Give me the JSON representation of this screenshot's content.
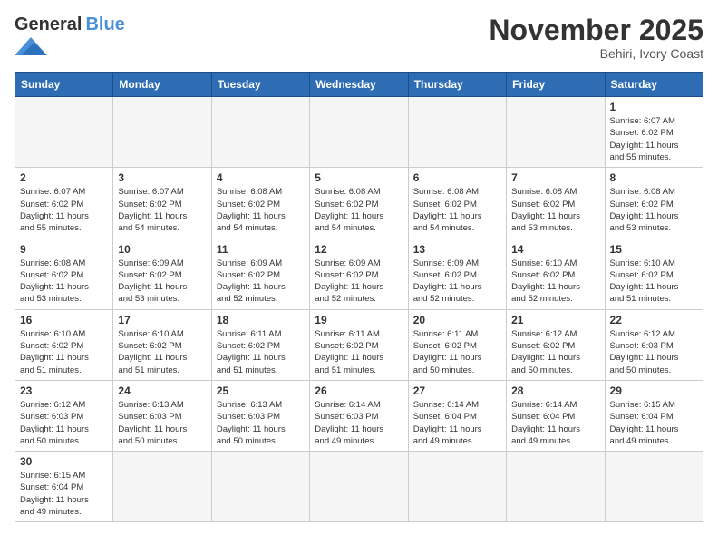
{
  "logo": {
    "general": "General",
    "blue": "Blue"
  },
  "title": "November 2025",
  "location": "Behiri, Ivory Coast",
  "days_header": [
    "Sunday",
    "Monday",
    "Tuesday",
    "Wednesday",
    "Thursday",
    "Friday",
    "Saturday"
  ],
  "weeks": [
    [
      {
        "day": "",
        "info": ""
      },
      {
        "day": "",
        "info": ""
      },
      {
        "day": "",
        "info": ""
      },
      {
        "day": "",
        "info": ""
      },
      {
        "day": "",
        "info": ""
      },
      {
        "day": "",
        "info": ""
      },
      {
        "day": "1",
        "info": "Sunrise: 6:07 AM\nSunset: 6:02 PM\nDaylight: 11 hours\nand 55 minutes."
      }
    ],
    [
      {
        "day": "2",
        "info": "Sunrise: 6:07 AM\nSunset: 6:02 PM\nDaylight: 11 hours\nand 55 minutes."
      },
      {
        "day": "3",
        "info": "Sunrise: 6:07 AM\nSunset: 6:02 PM\nDaylight: 11 hours\nand 54 minutes."
      },
      {
        "day": "4",
        "info": "Sunrise: 6:08 AM\nSunset: 6:02 PM\nDaylight: 11 hours\nand 54 minutes."
      },
      {
        "day": "5",
        "info": "Sunrise: 6:08 AM\nSunset: 6:02 PM\nDaylight: 11 hours\nand 54 minutes."
      },
      {
        "day": "6",
        "info": "Sunrise: 6:08 AM\nSunset: 6:02 PM\nDaylight: 11 hours\nand 54 minutes."
      },
      {
        "day": "7",
        "info": "Sunrise: 6:08 AM\nSunset: 6:02 PM\nDaylight: 11 hours\nand 53 minutes."
      },
      {
        "day": "8",
        "info": "Sunrise: 6:08 AM\nSunset: 6:02 PM\nDaylight: 11 hours\nand 53 minutes."
      }
    ],
    [
      {
        "day": "9",
        "info": "Sunrise: 6:08 AM\nSunset: 6:02 PM\nDaylight: 11 hours\nand 53 minutes."
      },
      {
        "day": "10",
        "info": "Sunrise: 6:09 AM\nSunset: 6:02 PM\nDaylight: 11 hours\nand 53 minutes."
      },
      {
        "day": "11",
        "info": "Sunrise: 6:09 AM\nSunset: 6:02 PM\nDaylight: 11 hours\nand 52 minutes."
      },
      {
        "day": "12",
        "info": "Sunrise: 6:09 AM\nSunset: 6:02 PM\nDaylight: 11 hours\nand 52 minutes."
      },
      {
        "day": "13",
        "info": "Sunrise: 6:09 AM\nSunset: 6:02 PM\nDaylight: 11 hours\nand 52 minutes."
      },
      {
        "day": "14",
        "info": "Sunrise: 6:10 AM\nSunset: 6:02 PM\nDaylight: 11 hours\nand 52 minutes."
      },
      {
        "day": "15",
        "info": "Sunrise: 6:10 AM\nSunset: 6:02 PM\nDaylight: 11 hours\nand 51 minutes."
      }
    ],
    [
      {
        "day": "16",
        "info": "Sunrise: 6:10 AM\nSunset: 6:02 PM\nDaylight: 11 hours\nand 51 minutes."
      },
      {
        "day": "17",
        "info": "Sunrise: 6:10 AM\nSunset: 6:02 PM\nDaylight: 11 hours\nand 51 minutes."
      },
      {
        "day": "18",
        "info": "Sunrise: 6:11 AM\nSunset: 6:02 PM\nDaylight: 11 hours\nand 51 minutes."
      },
      {
        "day": "19",
        "info": "Sunrise: 6:11 AM\nSunset: 6:02 PM\nDaylight: 11 hours\nand 51 minutes."
      },
      {
        "day": "20",
        "info": "Sunrise: 6:11 AM\nSunset: 6:02 PM\nDaylight: 11 hours\nand 50 minutes."
      },
      {
        "day": "21",
        "info": "Sunrise: 6:12 AM\nSunset: 6:02 PM\nDaylight: 11 hours\nand 50 minutes."
      },
      {
        "day": "22",
        "info": "Sunrise: 6:12 AM\nSunset: 6:03 PM\nDaylight: 11 hours\nand 50 minutes."
      }
    ],
    [
      {
        "day": "23",
        "info": "Sunrise: 6:12 AM\nSunset: 6:03 PM\nDaylight: 11 hours\nand 50 minutes."
      },
      {
        "day": "24",
        "info": "Sunrise: 6:13 AM\nSunset: 6:03 PM\nDaylight: 11 hours\nand 50 minutes."
      },
      {
        "day": "25",
        "info": "Sunrise: 6:13 AM\nSunset: 6:03 PM\nDaylight: 11 hours\nand 50 minutes."
      },
      {
        "day": "26",
        "info": "Sunrise: 6:14 AM\nSunset: 6:03 PM\nDaylight: 11 hours\nand 49 minutes."
      },
      {
        "day": "27",
        "info": "Sunrise: 6:14 AM\nSunset: 6:04 PM\nDaylight: 11 hours\nand 49 minutes."
      },
      {
        "day": "28",
        "info": "Sunrise: 6:14 AM\nSunset: 6:04 PM\nDaylight: 11 hours\nand 49 minutes."
      },
      {
        "day": "29",
        "info": "Sunrise: 6:15 AM\nSunset: 6:04 PM\nDaylight: 11 hours\nand 49 minutes."
      }
    ],
    [
      {
        "day": "30",
        "info": "Sunrise: 6:15 AM\nSunset: 6:04 PM\nDaylight: 11 hours\nand 49 minutes."
      },
      {
        "day": "",
        "info": ""
      },
      {
        "day": "",
        "info": ""
      },
      {
        "day": "",
        "info": ""
      },
      {
        "day": "",
        "info": ""
      },
      {
        "day": "",
        "info": ""
      },
      {
        "day": "",
        "info": ""
      }
    ]
  ]
}
